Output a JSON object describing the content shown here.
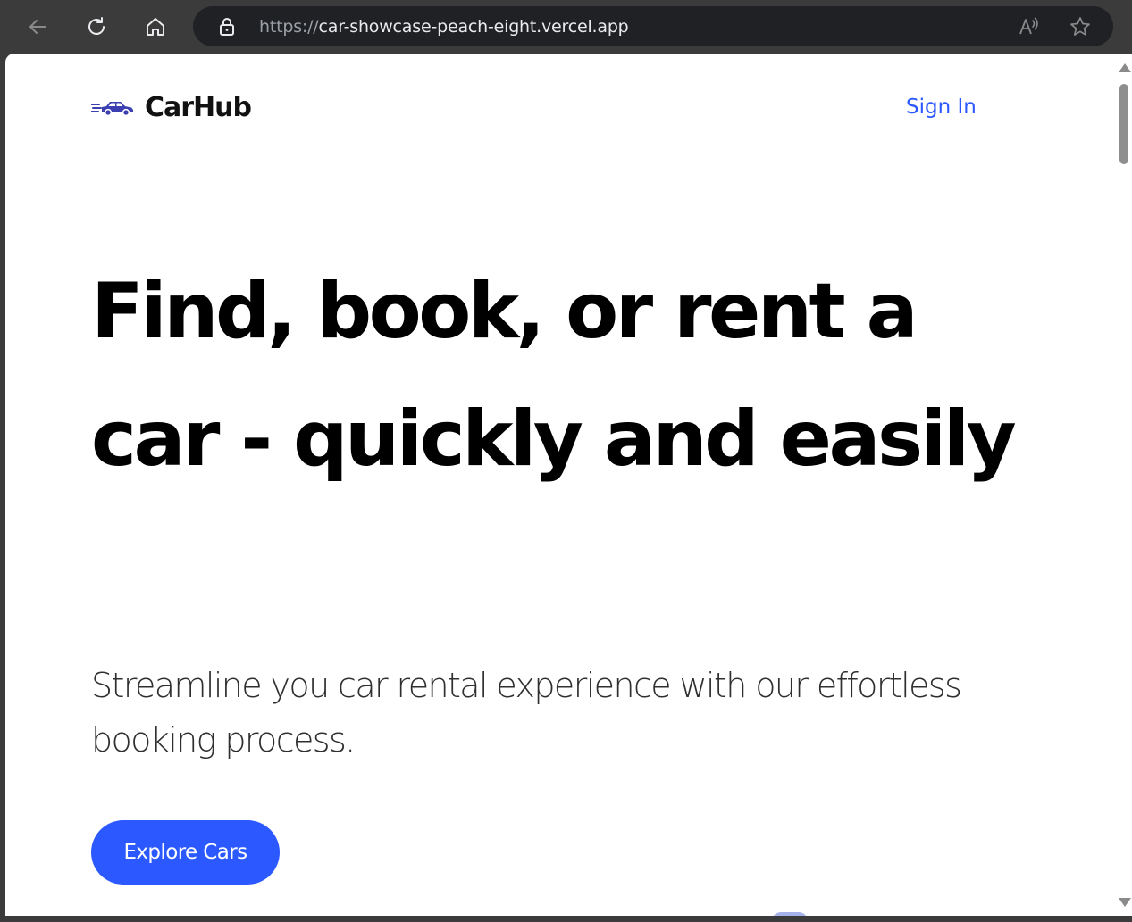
{
  "browser": {
    "url_scheme": "https://",
    "url_host": "car-showcase-peach-eight.vercel.app",
    "icons": [
      "back-arrow-icon",
      "reload-icon",
      "home-icon",
      "lock-icon",
      "read-aloud-icon",
      "star-icon"
    ]
  },
  "header": {
    "logo_text": "CarHub",
    "logo_icon": "car-icon",
    "sign_in_label": "Sign In"
  },
  "hero": {
    "title": "Find, book, or rent a car - quickly and easily",
    "subtitle": "Streamline you car rental experience with our effortless booking process.",
    "cta_label": "Explore Cars"
  },
  "colors": {
    "accent": "#2b59ff",
    "logo": "#3b3fb0",
    "text": "#000000",
    "chrome": "#3b3b3b"
  }
}
